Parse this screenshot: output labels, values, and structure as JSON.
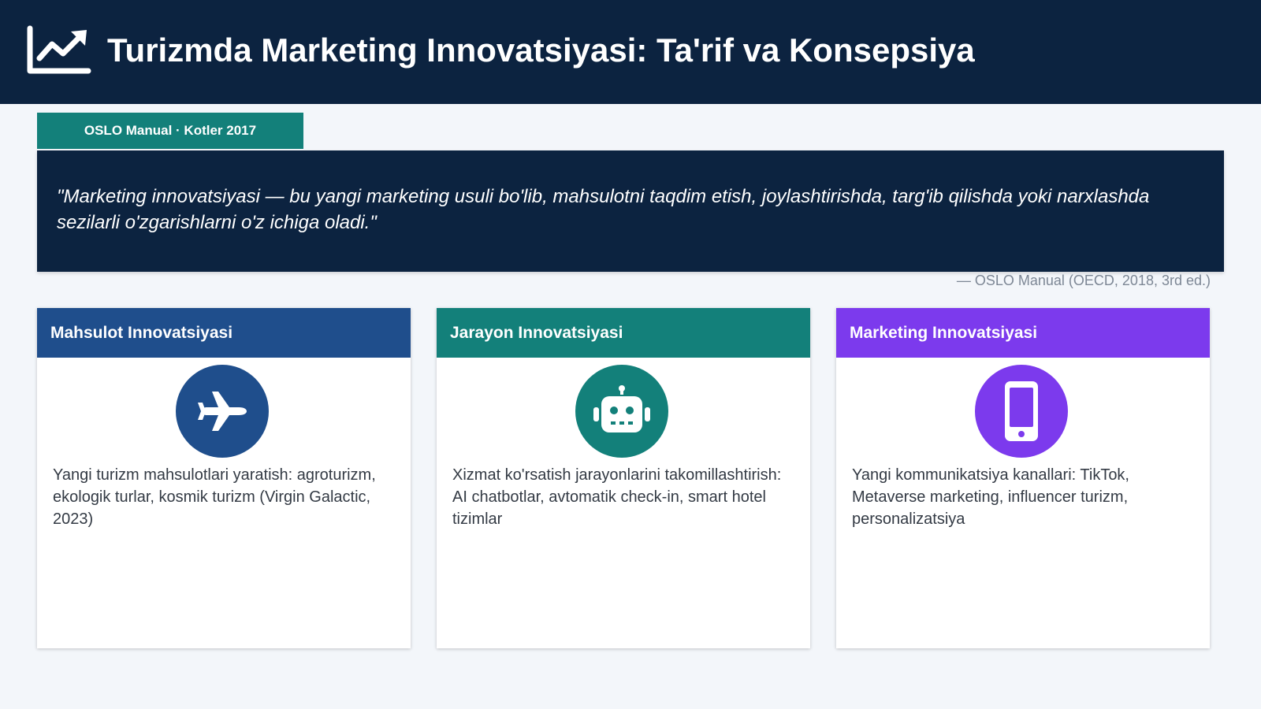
{
  "header": {
    "title": "Turizmda Marketing Innovatsiyasi: Ta'rif va Konsepsiya",
    "icon": "chart-line-icon"
  },
  "source_tag": "OSLO Manual · Kotler 2017",
  "quote": {
    "text": "\"Marketing innovatsiyasi — bu yangi marketing usuli bo'lib, mahsulotni taqdim etish, joylashtirishda, targ'ib qilishda yoki narxlashda sezilarli o'zgarishlarni o'z ichiga oladi.\"",
    "attribution": "— OSLO Manual (OECD, 2018, 3rd ed.)"
  },
  "cards": [
    {
      "title": "Mahsulot Innovatsiyasi",
      "icon": "airplane-icon",
      "color": "#1f4e8c",
      "text": "Yangi turizm mahsulotlari yaratish: agroturizm, ekologik turlar, kosmik turizm (Virgin Galactic, 2023)"
    },
    {
      "title": "Jarayon Innovatsiyasi",
      "icon": "robot-icon",
      "color": "#13807a",
      "text": "Xizmat ko'rsatish jarayonlarini takomillashtirish: AI chatbotlar, avtomatik check-in, smart hotel tizimlar"
    },
    {
      "title": "Marketing Innovatsiyasi",
      "icon": "smartphone-icon",
      "color": "#7c3aed",
      "text": "Yangi kommunikatsiya kanallari: TikTok, Metaverse marketing, influencer turizm, personalizatsiya"
    }
  ]
}
